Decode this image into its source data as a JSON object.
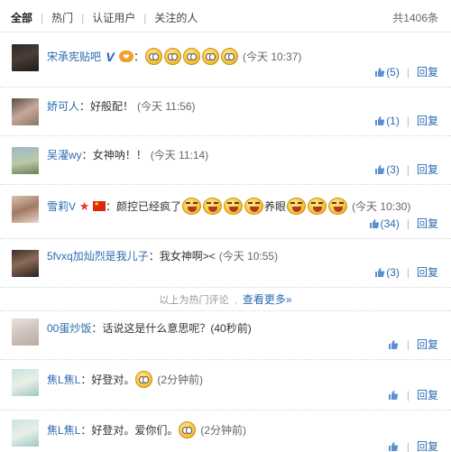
{
  "filters": {
    "tabs": [
      "全部",
      "热门",
      "认证用户",
      "关注的人"
    ],
    "total": "共1406条"
  },
  "colors": {
    "link": "#2a6bb0",
    "text": "#333333"
  },
  "comments": [
    {
      "username": "宋承宪贴吧",
      "badges": [
        "vip-v-icon",
        "member-icon"
      ],
      "text": "",
      "emoji_count": 5,
      "emoji_type": "sweat-smile-emoji",
      "time": "(今天 10:37)",
      "likes": "(5)",
      "reply": "回复"
    },
    {
      "username": "娇可人",
      "text": "好般配！",
      "time": "(今天 11:56)",
      "likes": "(1)",
      "reply": "回复"
    },
    {
      "username": "吴濯wy",
      "text": "女神呐！！",
      "time": "(今天 11:14)",
      "likes": "(3)",
      "reply": "回复"
    },
    {
      "username": "雪莉V",
      "badges": [
        "star-icon",
        "china-flag-icon"
      ],
      "text_before": "颜控已经疯了",
      "text_after": "养眼",
      "time": "(今天 10:30)",
      "likes": "(34)",
      "reply": "回复"
    },
    {
      "username": "5fvxq加灿烈是我儿子",
      "text": "我女神啊><",
      "time": "(今天 10:55)",
      "likes": "(3)",
      "reply": "回复"
    }
  ],
  "hot_divider": {
    "text": "以上为热门评论",
    "link": "查看更多»"
  },
  "recent": [
    {
      "username": "00蛋炒饭",
      "text": "话说这是什么意思呢？(40秒前)",
      "reply": "回复"
    },
    {
      "username": "焦L焦L",
      "text": "好登对。",
      "time": "(2分钟前)",
      "reply": "回复"
    },
    {
      "username": "焦L焦L",
      "text": "好登对。爱你们。",
      "time": "(2分钟前)",
      "reply": "回复"
    }
  ]
}
